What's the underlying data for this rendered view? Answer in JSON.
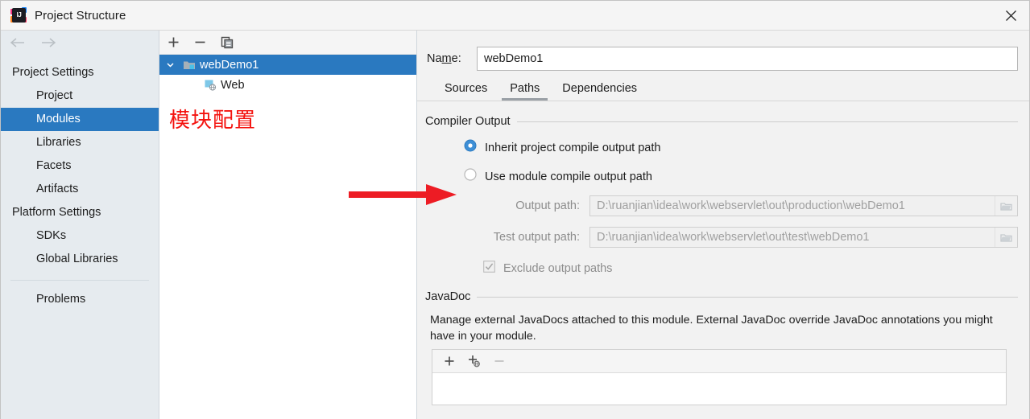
{
  "window": {
    "title": "Project Structure",
    "logo_icon": "intellij-idea-logo",
    "close_icon": "close-icon"
  },
  "sidebar": {
    "back_icon": "arrow-left-icon",
    "forward_icon": "arrow-right-icon",
    "groups": [
      {
        "label": "Project Settings",
        "items": [
          {
            "label": "Project",
            "selected": false
          },
          {
            "label": "Modules",
            "selected": true
          },
          {
            "label": "Libraries",
            "selected": false
          },
          {
            "label": "Facets",
            "selected": false
          },
          {
            "label": "Artifacts",
            "selected": false
          }
        ]
      },
      {
        "label": "Platform Settings",
        "items": [
          {
            "label": "SDKs",
            "selected": false
          },
          {
            "label": "Global Libraries",
            "selected": false
          }
        ]
      }
    ],
    "footer_item": {
      "label": "Problems"
    }
  },
  "tree": {
    "toolbar": [
      {
        "name": "add-module-button",
        "icon": "plus-icon"
      },
      {
        "name": "remove-module-button",
        "icon": "minus-icon"
      },
      {
        "name": "copy-module-button",
        "icon": "copy-icon"
      }
    ],
    "nodes": [
      {
        "label": "webDemo1",
        "icon": "module-folder-icon",
        "selected": true,
        "expanded": true,
        "depth": 0
      },
      {
        "label": "Web",
        "icon": "web-facet-icon",
        "selected": false,
        "depth": 1
      }
    ],
    "annotation": "模块配置",
    "annotation_color": "#f4130f"
  },
  "detail": {
    "name_label_before": "Na",
    "name_label_mnemonic": "m",
    "name_label_after": "e:",
    "name_value": "webDemo1",
    "tabs": [
      {
        "label": "Sources",
        "active": false
      },
      {
        "label": "Paths",
        "active": true
      },
      {
        "label": "Dependencies",
        "active": false
      }
    ],
    "compiler_output": {
      "section_title": "Compiler Output",
      "radios": [
        {
          "label": "Inherit project compile output path",
          "selected": true
        },
        {
          "label": "Use module compile output path",
          "selected": false
        }
      ],
      "fields": [
        {
          "label": "Output path:",
          "value": "D:\\ruanjian\\idea\\work\\webservlet\\out\\production\\webDemo1",
          "browse_icon": "folder-icon"
        },
        {
          "label": "Test output path:",
          "value": "D:\\ruanjian\\idea\\work\\webservlet\\out\\test\\webDemo1",
          "browse_icon": "folder-icon"
        }
      ],
      "checkbox": {
        "label": "Exclude output paths",
        "checked": true,
        "disabled": true
      }
    },
    "javadoc": {
      "section_title": "JavaDoc",
      "description": "Manage external JavaDocs attached to this module. External JavaDoc override JavaDoc annotations you might have in your module.",
      "toolbar": [
        {
          "name": "add-javadoc-button",
          "icon": "plus-icon"
        },
        {
          "name": "add-javadoc-url-button",
          "icon": "plus-globe-icon"
        },
        {
          "name": "remove-javadoc-button",
          "icon": "minus-icon"
        }
      ]
    }
  },
  "annotations": {
    "arrow_color": "#ed1c24",
    "arrow_target": "use-module-compile-output-path-radio"
  },
  "colors": {
    "selection_blue": "#2a79c0",
    "annotation_red": "#f4130f",
    "radio_blue": "#3e8fd6"
  }
}
